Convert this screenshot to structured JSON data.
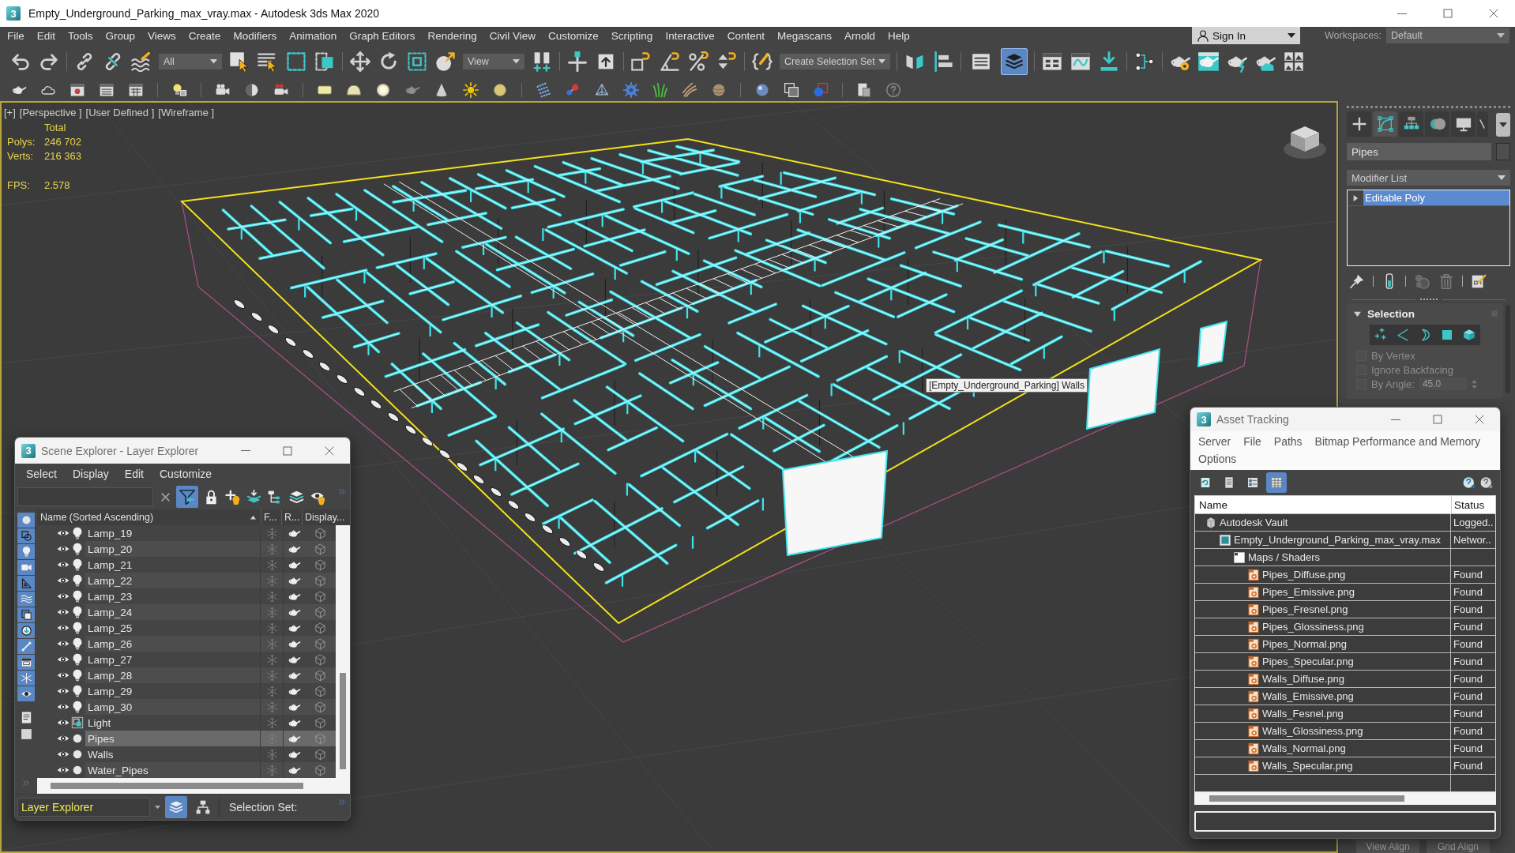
{
  "window": {
    "logo": "3",
    "title": "Empty_Underground_Parking_max_vray.max - Autodesk 3ds Max 2020"
  },
  "menu_bar": {
    "items": [
      "File",
      "Edit",
      "Tools",
      "Group",
      "Views",
      "Create",
      "Modifiers",
      "Animation",
      "Graph Editors",
      "Rendering",
      "Civil View",
      "Customize",
      "Scripting",
      "Interactive",
      "Content",
      "Megascans",
      "Arnold",
      "Help"
    ],
    "sign_in": "Sign In",
    "workspaces_label": "Workspaces:",
    "workspace": "Default"
  },
  "main_toolbar": {
    "selection_filter": "All",
    "reference_coordinate_system": "View",
    "named_selection_set": "Create Selection Set",
    "scene_explorer_toggle": {
      "selected": false
    },
    "layer_explorer_toggle": {
      "selected": true
    }
  },
  "viewport": {
    "labels": [
      "[+]",
      "[Perspective ]",
      "[User Defined ]",
      "[Wireframe ]"
    ],
    "stats": {
      "heading": "Total",
      "rows": [
        {
          "label": "Polys:",
          "value": "246 702"
        },
        {
          "label": "Verts:",
          "value": "216 363"
        }
      ],
      "fps": {
        "label": "FPS:",
        "value": "2.578"
      }
    },
    "tooltip": "[Empty_Underground_Parking] Walls"
  },
  "command_panel": {
    "tabs": [
      {
        "kind": "create",
        "selected": false
      },
      {
        "kind": "modify",
        "selected": true
      },
      {
        "kind": "hierarchy",
        "selected": false
      },
      {
        "kind": "motion",
        "selected": false
      },
      {
        "kind": "display",
        "selected": false
      },
      {
        "kind": "utilities",
        "selected": false
      }
    ],
    "object_name": "Pipes",
    "modifier_list": "Modifier List",
    "stack": [
      {
        "name": "Editable Poly",
        "selected": true,
        "expanded": false
      }
    ],
    "rollout": {
      "title": "Selection",
      "expanded": true,
      "subobject_levels": [
        {
          "kind": "vertex",
          "selected": false
        },
        {
          "kind": "edge",
          "selected": false
        },
        {
          "kind": "border",
          "selected": false
        },
        {
          "kind": "polygon",
          "selected": false
        },
        {
          "kind": "element",
          "selected": false
        }
      ],
      "options": [
        {
          "label": "By Vertex",
          "checked": false,
          "disabled": true
        },
        {
          "label": "Ignore Backfacing",
          "checked": false,
          "disabled": true
        },
        {
          "label": "By Angle:",
          "checked": false,
          "disabled": true,
          "value": "45.0"
        }
      ]
    },
    "buttons": [
      "View Align",
      "Grid Align"
    ]
  },
  "scene_explorer": {
    "logo": "3",
    "title": "Scene Explorer - Layer Explorer",
    "menu": [
      "Select",
      "Display",
      "Edit",
      "Customize"
    ],
    "filter_toggle": {
      "selected": true
    },
    "side_filters": [
      {
        "kind": "geometry",
        "on": true
      },
      {
        "kind": "shapes",
        "on": true
      },
      {
        "kind": "lights",
        "on": true
      },
      {
        "kind": "cameras",
        "on": true
      },
      {
        "kind": "helpers",
        "on": true
      },
      {
        "kind": "spacewarps",
        "on": true
      },
      {
        "kind": "groups",
        "on": true
      },
      {
        "kind": "xrefs",
        "on": true
      },
      {
        "kind": "bones",
        "on": true
      },
      {
        "kind": "containers",
        "on": true
      },
      {
        "kind": "frozen",
        "on": true
      },
      {
        "kind": "hidden",
        "on": true
      }
    ],
    "columns": [
      "Name (Sorted Ascending)",
      "F...",
      "R...",
      "Display..."
    ],
    "sort_ascending": true,
    "rows": [
      {
        "name": "Lamp_19",
        "kind": "light",
        "visible": true,
        "selected": false
      },
      {
        "name": "Lamp_20",
        "kind": "light",
        "visible": true,
        "selected": false
      },
      {
        "name": "Lamp_21",
        "kind": "light",
        "visible": true,
        "selected": false
      },
      {
        "name": "Lamp_22",
        "kind": "light",
        "visible": true,
        "selected": false
      },
      {
        "name": "Lamp_23",
        "kind": "light",
        "visible": true,
        "selected": false
      },
      {
        "name": "Lamp_24",
        "kind": "light",
        "visible": true,
        "selected": false
      },
      {
        "name": "Lamp_25",
        "kind": "light",
        "visible": true,
        "selected": false
      },
      {
        "name": "Lamp_26",
        "kind": "light",
        "visible": true,
        "selected": false
      },
      {
        "name": "Lamp_27",
        "kind": "light",
        "visible": true,
        "selected": false
      },
      {
        "name": "Lamp_28",
        "kind": "light",
        "visible": true,
        "selected": false
      },
      {
        "name": "Lamp_29",
        "kind": "light",
        "visible": true,
        "selected": false
      },
      {
        "name": "Lamp_30",
        "kind": "light",
        "visible": true,
        "selected": false
      },
      {
        "name": "Light",
        "kind": "group",
        "visible": true,
        "selected": false
      },
      {
        "name": "Pipes",
        "kind": "object",
        "visible": true,
        "selected": true
      },
      {
        "name": "Walls",
        "kind": "object",
        "visible": true,
        "selected": false
      },
      {
        "name": "Water_Pipes",
        "kind": "object",
        "visible": true,
        "selected": false
      }
    ],
    "explorer_mode": "Layer Explorer",
    "layer_view": {
      "selected": true
    },
    "hierarchy_view": {
      "selected": false
    },
    "selection_set_label": "Selection Set:"
  },
  "asset_tracking": {
    "logo": "3",
    "title": "Asset Tracking",
    "menu": [
      "Server",
      "File",
      "Paths",
      "Bitmap Performance and Memory",
      "Options"
    ],
    "view_buttons": [
      {
        "kind": "refresh",
        "selected": false
      },
      {
        "kind": "list",
        "selected": false
      },
      {
        "kind": "thumbnails",
        "selected": false
      },
      {
        "kind": "table",
        "selected": true
      }
    ],
    "columns": [
      "Name",
      "Status"
    ],
    "tree": [
      {
        "name": "Autodesk Vault",
        "kind": "vault",
        "status": "Logged..",
        "children": [
          {
            "name": "Empty_Underground_Parking_max_vray.max",
            "kind": "scene",
            "status": "Networ..",
            "children": [
              {
                "name": "Maps / Shaders",
                "kind": "folder",
                "children": [
                  {
                    "name": "Pipes_Diffuse.png",
                    "kind": "bitmap",
                    "status": "Found"
                  },
                  {
                    "name": "Pipes_Emissive.png",
                    "kind": "bitmap",
                    "status": "Found"
                  },
                  {
                    "name": "Pipes_Fresnel.png",
                    "kind": "bitmap",
                    "status": "Found"
                  },
                  {
                    "name": "Pipes_Glossiness.png",
                    "kind": "bitmap",
                    "status": "Found"
                  },
                  {
                    "name": "Pipes_Normal.png",
                    "kind": "bitmap",
                    "status": "Found"
                  },
                  {
                    "name": "Pipes_Specular.png",
                    "kind": "bitmap",
                    "status": "Found"
                  },
                  {
                    "name": "Walls_Diffuse.png",
                    "kind": "bitmap",
                    "status": "Found"
                  },
                  {
                    "name": "Walls_Emissive.png",
                    "kind": "bitmap",
                    "status": "Found"
                  },
                  {
                    "name": "Walls_Fesnel.png",
                    "kind": "bitmap",
                    "status": "Found"
                  },
                  {
                    "name": "Walls_Glossiness.png",
                    "kind": "bitmap",
                    "status": "Found"
                  },
                  {
                    "name": "Walls_Normal.png",
                    "kind": "bitmap",
                    "status": "Found"
                  },
                  {
                    "name": "Walls_Specular.png",
                    "kind": "bitmap",
                    "status": "Found"
                  }
                ]
              }
            ]
          }
        ]
      }
    ]
  }
}
